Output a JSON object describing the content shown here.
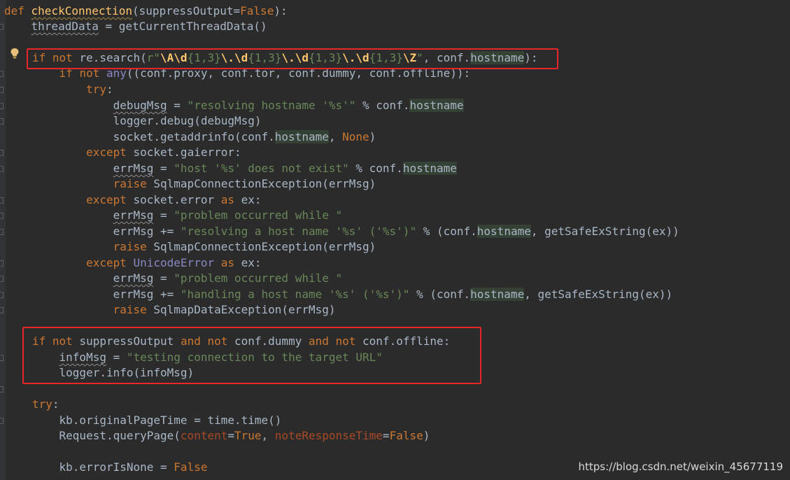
{
  "lines": [
    {
      "id": "L1",
      "parts": [
        [
          "def ",
          "kw"
        ],
        [
          "checkConnection",
          "fn fsq"
        ],
        [
          "(suppressOutput=",
          ""
        ],
        [
          "False",
          "kw"
        ],
        [
          "):",
          ""
        ]
      ]
    },
    {
      "id": "L2",
      "parts": [
        [
          "    ",
          ""
        ],
        [
          "threadData",
          "sq"
        ],
        [
          " = getCurrentThreadData()",
          ""
        ]
      ]
    },
    {
      "id": "L3",
      "parts": []
    },
    {
      "id": "L4",
      "parts": [
        [
          "if ",
          "kw"
        ],
        [
          "not ",
          "kw"
        ],
        [
          "re.search(",
          ""
        ],
        [
          "r\"",
          "str"
        ],
        [
          "\\A\\d",
          "re"
        ],
        [
          "{1,3}",
          "str"
        ],
        [
          "\\.\\d",
          "re"
        ],
        [
          "{1,3}",
          "str"
        ],
        [
          "\\.\\d",
          "re"
        ],
        [
          "{1,3}",
          "str"
        ],
        [
          "\\.\\d",
          "re"
        ],
        [
          "{1,3}",
          "str"
        ],
        [
          "\\Z",
          "re"
        ],
        [
          "\"",
          "str"
        ],
        [
          ", conf.",
          ""
        ],
        [
          "hostname",
          "hl"
        ],
        [
          "):",
          ""
        ]
      ]
    },
    {
      "id": "L5",
      "parts": [
        [
          "    ",
          ""
        ],
        [
          "if ",
          "kw"
        ],
        [
          "not ",
          "kw"
        ],
        [
          "any",
          "bi"
        ],
        [
          "((conf.proxy, conf.tor, conf.dummy, conf.offline)):",
          ""
        ]
      ]
    },
    {
      "id": "L6",
      "parts": [
        [
          "        ",
          ""
        ],
        [
          "try",
          "kw"
        ],
        [
          ":",
          ""
        ]
      ]
    },
    {
      "id": "L7",
      "parts": [
        [
          "            ",
          ""
        ],
        [
          "debugMsg",
          "sq"
        ],
        [
          " = ",
          ""
        ],
        [
          "\"resolving hostname '%s'\"",
          "str"
        ],
        [
          " % conf.",
          ""
        ],
        [
          "hostname",
          "hl"
        ]
      ]
    },
    {
      "id": "L8",
      "parts": [
        [
          "            logger.debug(debugMsg)",
          ""
        ]
      ]
    },
    {
      "id": "L9",
      "parts": [
        [
          "            socket.getaddrinfo(conf.",
          ""
        ],
        [
          "hostname",
          "hl"
        ],
        [
          ", ",
          ""
        ],
        [
          "None",
          "kw"
        ],
        [
          ")",
          ""
        ]
      ]
    },
    {
      "id": "L10",
      "parts": [
        [
          "        ",
          ""
        ],
        [
          "except ",
          "kw"
        ],
        [
          "socket.gaierror:",
          ""
        ]
      ]
    },
    {
      "id": "L11",
      "parts": [
        [
          "            ",
          ""
        ],
        [
          "errMsg",
          "sq"
        ],
        [
          " = ",
          ""
        ],
        [
          "\"host '%s' does not exist\"",
          "str"
        ],
        [
          " % conf.",
          ""
        ],
        [
          "hostname",
          "hl"
        ]
      ]
    },
    {
      "id": "L12",
      "parts": [
        [
          "            ",
          ""
        ],
        [
          "raise ",
          "kw"
        ],
        [
          "SqlmapConnectionException(errMsg)",
          ""
        ]
      ]
    },
    {
      "id": "L13",
      "parts": [
        [
          "        ",
          ""
        ],
        [
          "except ",
          "kw"
        ],
        [
          "socket.error ",
          ""
        ],
        [
          "as ",
          "kw"
        ],
        [
          "ex:",
          ""
        ]
      ]
    },
    {
      "id": "L14",
      "parts": [
        [
          "            ",
          ""
        ],
        [
          "errMsg",
          "sq"
        ],
        [
          " = ",
          ""
        ],
        [
          "\"problem occurred while \"",
          "str"
        ]
      ]
    },
    {
      "id": "L15",
      "parts": [
        [
          "            errMsg += ",
          ""
        ],
        [
          "\"resolving a host name '%s' ('%s')\"",
          "str"
        ],
        [
          " % (conf.",
          ""
        ],
        [
          "hostname",
          "hl"
        ],
        [
          ", getSafeExString(ex))",
          ""
        ]
      ]
    },
    {
      "id": "L16",
      "parts": [
        [
          "            ",
          ""
        ],
        [
          "raise ",
          "kw"
        ],
        [
          "SqlmapConnectionException(errMsg)",
          ""
        ]
      ]
    },
    {
      "id": "L17",
      "parts": [
        [
          "        ",
          ""
        ],
        [
          "except ",
          "kw"
        ],
        [
          "UnicodeError ",
          "bi"
        ],
        [
          "as ",
          "kw"
        ],
        [
          "ex:",
          ""
        ]
      ]
    },
    {
      "id": "L18",
      "parts": [
        [
          "            ",
          ""
        ],
        [
          "errMsg",
          "sq"
        ],
        [
          " = ",
          ""
        ],
        [
          "\"problem occurred while \"",
          "str"
        ]
      ]
    },
    {
      "id": "L19",
      "parts": [
        [
          "            errMsg += ",
          ""
        ],
        [
          "\"handling a host name '%s' ('%s')\"",
          "str"
        ],
        [
          " % (conf.",
          ""
        ],
        [
          "hostname",
          "hl"
        ],
        [
          ", getSafeExString(ex))",
          ""
        ]
      ]
    },
    {
      "id": "L20",
      "parts": [
        [
          "            ",
          ""
        ],
        [
          "raise ",
          "kw"
        ],
        [
          "SqlmapDataException(errMsg)",
          ""
        ]
      ]
    },
    {
      "id": "L21",
      "parts": []
    },
    {
      "id": "L22",
      "parts": [
        [
          "if ",
          "kw"
        ],
        [
          "not ",
          "kw"
        ],
        [
          "suppressOutput ",
          ""
        ],
        [
          "and ",
          "kw"
        ],
        [
          "not ",
          "kw"
        ],
        [
          "conf.dummy ",
          ""
        ],
        [
          "and ",
          "kw"
        ],
        [
          "not ",
          "kw"
        ],
        [
          "conf.offline:",
          ""
        ]
      ]
    },
    {
      "id": "L23",
      "parts": [
        [
          "    ",
          ""
        ],
        [
          "infoMsg",
          "sq"
        ],
        [
          " = ",
          ""
        ],
        [
          "\"testing connection to the target URL\"",
          "str"
        ]
      ]
    },
    {
      "id": "L24",
      "parts": [
        [
          "    logger.info(infoMsg)",
          ""
        ]
      ]
    },
    {
      "id": "L25",
      "parts": []
    },
    {
      "id": "L26",
      "parts": [
        [
          "try",
          "kw"
        ],
        [
          ":",
          ""
        ]
      ]
    },
    {
      "id": "L27",
      "parts": [
        [
          "    kb.originalPageTime = time.time()",
          ""
        ]
      ]
    },
    {
      "id": "L28",
      "parts": [
        [
          "    Request.queryPage(",
          ""
        ],
        [
          "content",
          "param"
        ],
        [
          "=",
          ""
        ],
        [
          "True",
          "kw"
        ],
        [
          ", ",
          ""
        ],
        [
          "noteResponseTime",
          "param"
        ],
        [
          "=",
          ""
        ],
        [
          "False",
          "kw"
        ],
        [
          ")",
          ""
        ]
      ]
    },
    {
      "id": "L29",
      "parts": []
    },
    {
      "id": "L30",
      "parts": [
        [
          "    kb.errorIsNone = ",
          ""
        ],
        [
          "False",
          "kw"
        ]
      ]
    }
  ],
  "watermark": "https://blog.csdn.net/weixin_45677119",
  "icons": {
    "intention": "lightbulb-icon",
    "fold": "fold-marker-icon"
  },
  "colors": {
    "background": "#2b2b2b",
    "keyword": "#cc7832",
    "string": "#6a8759",
    "function": "#ffc66d",
    "number": "#6897bb",
    "highlight": "#e8262a"
  }
}
